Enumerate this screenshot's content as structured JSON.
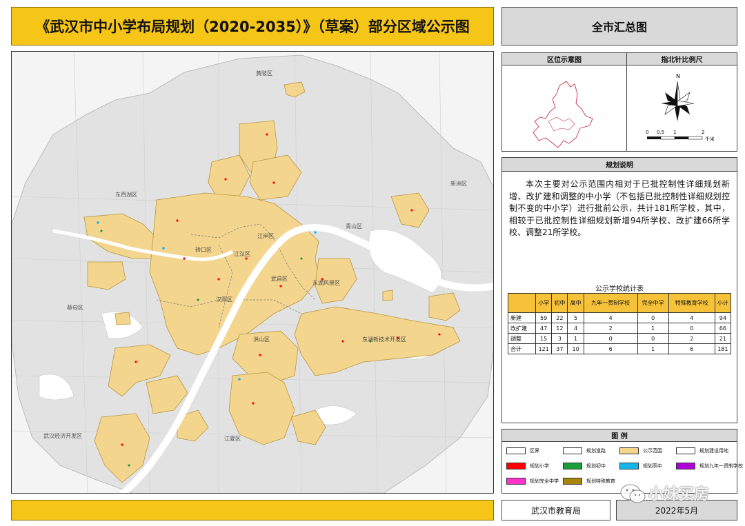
{
  "header": {
    "title": "《武汉市中小学布局规划（2020-2035）》（草案）部分区域公示图",
    "panel_title": "全市汇总图"
  },
  "map": {
    "districts": [
      "黄陂区",
      "东西湖区",
      "新洲区",
      "硚口区",
      "江岸区",
      "江汉区",
      "青山区",
      "汉阳区",
      "武昌区",
      "东湖风景区",
      "蔡甸区",
      "洪山区",
      "东湖新技术开发区",
      "武汉经济开发区",
      "江夏区"
    ],
    "colors": {
      "background": "#e3e3e3",
      "public_area": "#f3d58e",
      "public_area_border": "#b8963e",
      "water": "#ffffff",
      "primary_school": "#ff0000",
      "junior_middle": "#1a9e3a",
      "senior_high": "#12b5ea",
      "nine_year": "#b000d8",
      "complete_middle": "#ff33cc",
      "special_education": "#a8860a"
    }
  },
  "location_panel": {
    "location_title": "区位示意图",
    "compass_title": "指北针比例尺",
    "north_label": "N",
    "scale_ticks": [
      "0",
      "0.5",
      "1",
      "2"
    ],
    "scale_unit": "千米"
  },
  "description": {
    "title": "规划说明",
    "text": "本次主要对公示范围内相对于已批控制性详细规划新增、改扩建和调整的中小学（不包括已批控制性详细规划控制不变的中小学）进行批前公示，共计181所学校，其中，相较于已批控制性详细规划新增94所学校、改扩建66所学校、调整21所学校。"
  },
  "stats_table": {
    "title": "公示学校统计表",
    "columns": [
      "",
      "小学",
      "初中",
      "高中",
      "九年一贯制学校",
      "完全中学",
      "特殊教育学校",
      "小计"
    ],
    "rows": [
      {
        "label": "新建",
        "values": [
          "59",
          "22",
          "5",
          "4",
          "0",
          "4",
          "94"
        ]
      },
      {
        "label": "改扩建",
        "values": [
          "47",
          "12",
          "4",
          "2",
          "1",
          "0",
          "66"
        ]
      },
      {
        "label": "调整",
        "values": [
          "15",
          "3",
          "1",
          "0",
          "0",
          "2",
          "21"
        ]
      },
      {
        "label": "合计",
        "values": [
          "121",
          "37",
          "10",
          "6",
          "1",
          "6",
          "181"
        ]
      }
    ]
  },
  "legend": {
    "title": "图  例",
    "items": [
      {
        "label": "区界",
        "color": "#ffffff"
      },
      {
        "label": "规划道路",
        "color": "#ffffff"
      },
      {
        "label": "公示范围",
        "color": "#f3d58e"
      },
      {
        "label": "规划建设用地",
        "color": "#ffffff"
      },
      {
        "label": "规划小学",
        "color": "#ff0000"
      },
      {
        "label": "规划初中",
        "color": "#1a9e3a"
      },
      {
        "label": "规划高中",
        "color": "#12b5ea"
      },
      {
        "label": "规划九年一贯制学校",
        "color": "#b000d8"
      },
      {
        "label": "规划完全中学",
        "color": "#ff33cc"
      },
      {
        "label": "规划特殊教育",
        "color": "#a8860a"
      }
    ]
  },
  "footer": {
    "agency": "武汉市教育局",
    "date": "2022年5月"
  },
  "watermark": {
    "text": "小妹买房"
  }
}
